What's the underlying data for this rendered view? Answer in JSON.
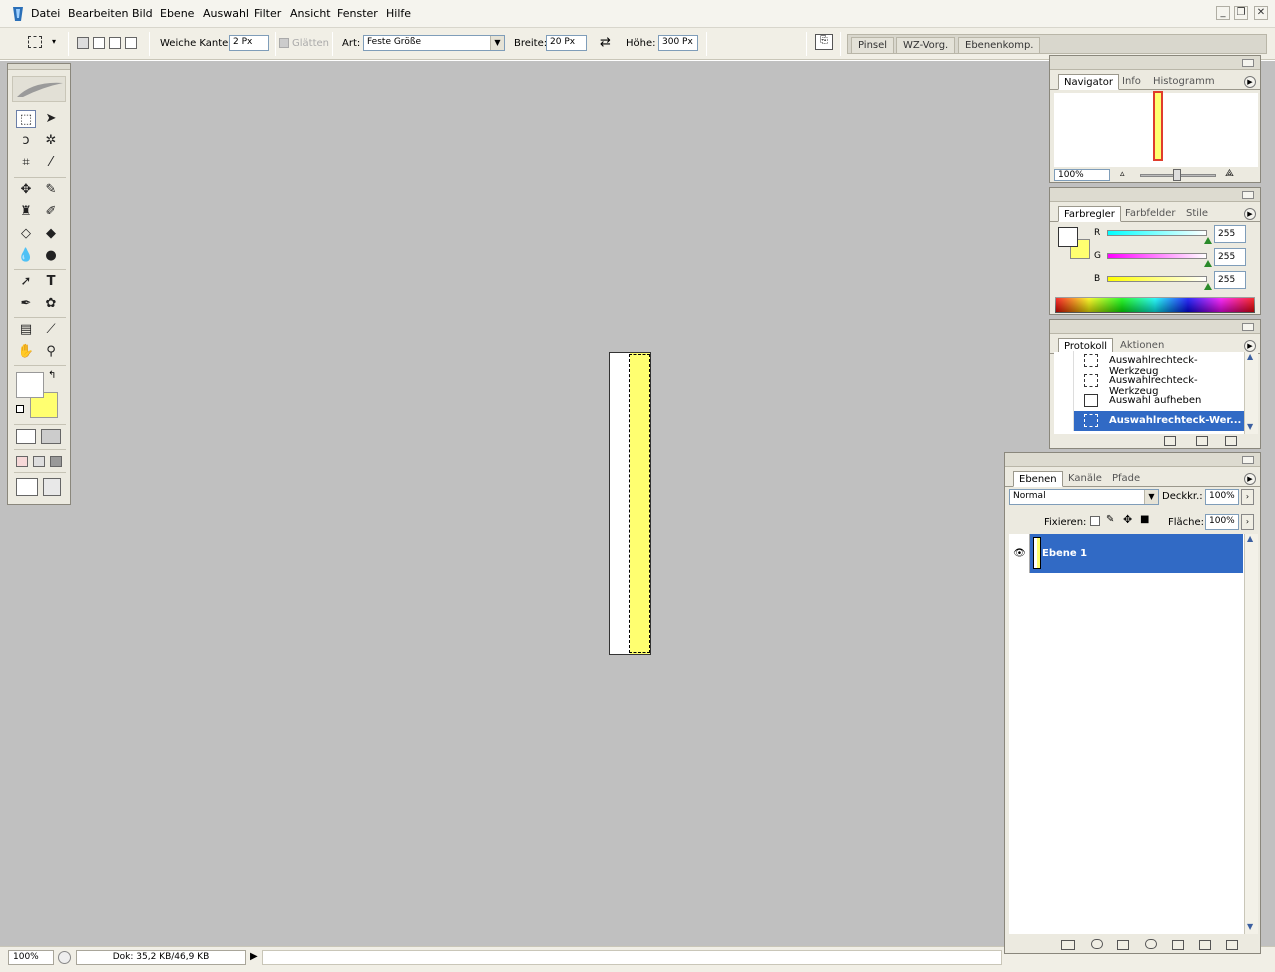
{
  "menubar": {
    "items": [
      "Datei",
      "Bearbeiten",
      "Bild",
      "Ebene",
      "Auswahl",
      "Filter",
      "Ansicht",
      "Fenster",
      "Hilfe"
    ]
  },
  "options": {
    "feather_label": "Weiche Kante:",
    "feather_value": "2 Px",
    "antialias_label": "Glätten",
    "style_label": "Art:",
    "style_value": "Feste Größe",
    "width_label": "Breite:",
    "width_value": "20 Px",
    "height_label": "Höhe:",
    "height_value": "300 Px",
    "dock_tabs": [
      "Pinsel",
      "WZ-Vorg.",
      "Ebenenkomp."
    ]
  },
  "status": {
    "zoom": "100%",
    "doc": "Dok: 35,2 KB/46,9 KB"
  },
  "navigator": {
    "tabs": [
      "Navigator",
      "Info",
      "Histogramm"
    ],
    "zoom": "100%",
    "thumb_color": "#e03c2c"
  },
  "color": {
    "tabs": [
      "Farbregler",
      "Farbfelder",
      "Stile"
    ],
    "r_label": "R",
    "g_label": "G",
    "b_label": "B",
    "r_value": "255",
    "g_value": "255",
    "b_value": "255",
    "foreground": "#ffffff",
    "background": "#ffff70"
  },
  "history": {
    "tabs": [
      "Protokoll",
      "Aktionen"
    ],
    "items": [
      "Auswahlrechteck-Werkzeug",
      "Auswahlrechteck-Werkzeug",
      "Auswahl aufheben",
      "Auswahlrechteck-Wer..."
    ]
  },
  "layers": {
    "tabs": [
      "Ebenen",
      "Kanäle",
      "Pfade"
    ],
    "blend_mode": "Normal",
    "opacity_label": "Deckkr.:",
    "opacity_value": "100%",
    "lock_label": "Fixieren:",
    "fill_label": "Fläche:",
    "fill_value": "100%",
    "layer_name": "Ebene 1"
  }
}
